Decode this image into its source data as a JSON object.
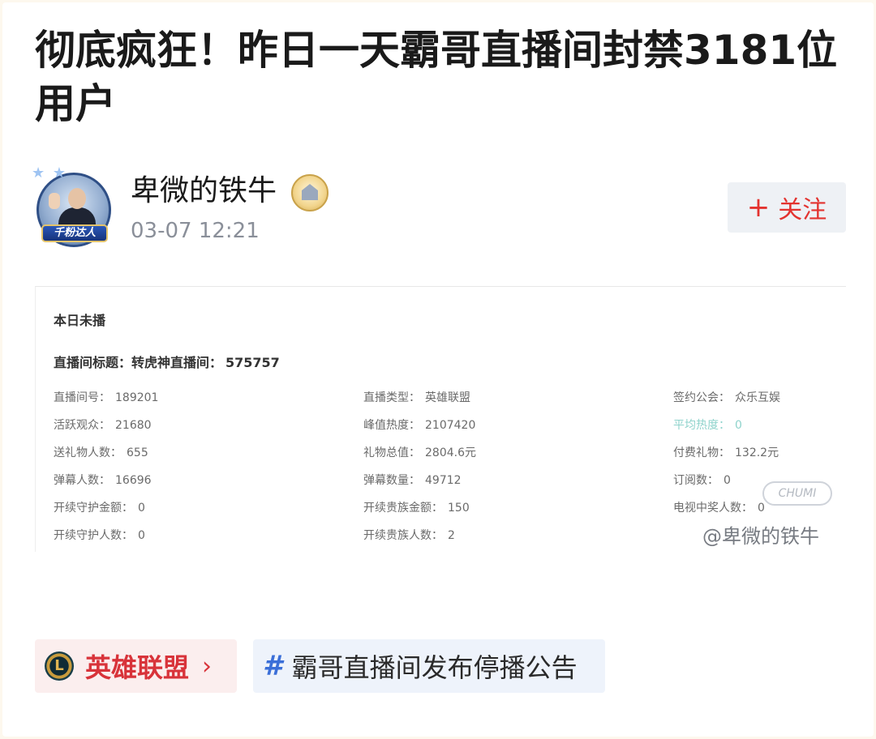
{
  "post": {
    "title": "彻底疯狂！昨日一天霸哥直播间封禁3181位用户",
    "author": "卑微的铁牛",
    "time": "03-07 12:21",
    "fan_badge": "千粉达人",
    "follow_label": "关注",
    "follow_plus": "+"
  },
  "screenshot": {
    "heading": "本日未播",
    "title_label": "直播间标题：转虎神直播间：",
    "title_value": "575757",
    "stats_col1": [
      {
        "label": "直播间号：",
        "value": "189201"
      },
      {
        "label": "活跃观众：",
        "value": "21680"
      },
      {
        "label": "送礼物人数：",
        "value": "655"
      },
      {
        "label": "弹幕人数：",
        "value": "16696"
      },
      {
        "label": "开续守护金额：",
        "value": "0"
      },
      {
        "label": "开续守护人数：",
        "value": "0"
      }
    ],
    "stats_col2": [
      {
        "label": "直播类型：",
        "value": "英雄联盟"
      },
      {
        "label": "峰值热度：",
        "value": "2107420"
      },
      {
        "label": "礼物总值：",
        "value": "2804.6元"
      },
      {
        "label": "弹幕数量：",
        "value": "49712"
      },
      {
        "label": "开续贵族金额：",
        "value": "150"
      },
      {
        "label": "开续贵族人数：",
        "value": "2"
      }
    ],
    "stats_col3": [
      {
        "label": "签约公会：",
        "value": "众乐互娱"
      },
      {
        "label": "平均热度：",
        "value": "0"
      },
      {
        "label": "付费礼物：",
        "value": "132.2元"
      },
      {
        "label": "订阅数：",
        "value": "0"
      },
      {
        "label": "电视中奖人数：",
        "value": "0"
      }
    ],
    "watermark_logo": "CHUMI",
    "watermark": "@卑微的铁牛"
  },
  "tags": {
    "topic": "英雄联盟",
    "topic_chevron": "›",
    "hashtag_symbol": "#",
    "hashtag": "霸哥直播间发布停播公告"
  },
  "icons": {
    "avatar": "avatar-image",
    "verified": "verified-badge-icon",
    "game": "league-of-legends-icon",
    "hashtag": "hashtag-icon"
  },
  "colors": {
    "follow": "#e3332f",
    "topic": "#d8333a",
    "hashtag_icon": "#3b6fd8",
    "time": "#8a8f99"
  }
}
